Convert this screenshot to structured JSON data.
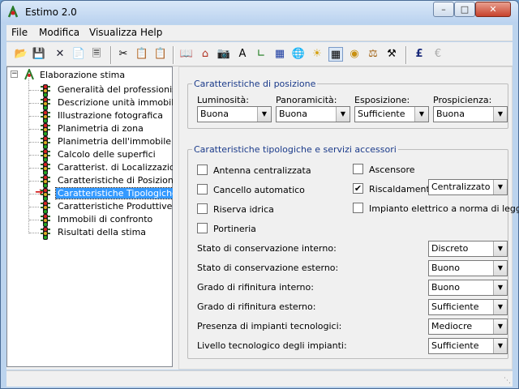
{
  "window": {
    "title": "Estimo 2.0",
    "min": "–",
    "max": "□",
    "close": "✕"
  },
  "menu": [
    "File",
    "Modifica",
    "Visualizza",
    "Help"
  ],
  "toolbar": {
    "euro": "€",
    "pound": "£"
  },
  "tree": {
    "root": "Elaborazione stima",
    "items": [
      "Generalità del professionista",
      "Descrizione unità immobiliare",
      "Illustrazione fotografica",
      "Planimetria di zona",
      "Planimetria dell'immobile",
      "Calcolo delle superfici",
      "Caratterist. di Localizzazione",
      "Caratteristiche di Posizione",
      "Caratteristiche Tipologiche",
      "Caratteristiche Produttive",
      "Immobili di confronto",
      "Risultati della stima"
    ],
    "selected_index": 8
  },
  "posizione": {
    "legend": "Caratteristiche di posizione",
    "fields": [
      {
        "label": "Luminosità:",
        "value": "Buona"
      },
      {
        "label": "Panoramicità:",
        "value": "Buona"
      },
      {
        "label": "Esposizione:",
        "value": "Sufficiente"
      },
      {
        "label": "Prospicienza:",
        "value": "Buona"
      }
    ]
  },
  "tipologiche": {
    "legend": "Caratteristiche tipologiche e servizi accessori",
    "checks": [
      {
        "label": "Antenna centralizzata",
        "checked": false
      },
      {
        "label": "Cancello automatico",
        "checked": false
      },
      {
        "label": "Riserva idrica",
        "checked": false
      },
      {
        "label": "Portineria",
        "checked": false
      },
      {
        "label": "Ascensore",
        "checked": false
      },
      {
        "label": "Riscaldamento",
        "checked": true,
        "value": "Centralizzato"
      },
      {
        "label": "Impianto elettrico a norma di legge",
        "checked": false
      }
    ],
    "rows": [
      {
        "label": "Stato di conservazione interno:",
        "value": "Discreto"
      },
      {
        "label": "Stato di conservazione esterno:",
        "value": "Buono"
      },
      {
        "label": "Grado di rifinitura interno:",
        "value": "Buono"
      },
      {
        "label": "Grado di rifinitura esterno:",
        "value": "Sufficiente"
      },
      {
        "label": "Presenza di impianti tecnologici:",
        "value": "Mediocre"
      },
      {
        "label": "Livello tecnologico degli impianti:",
        "value": "Sufficiente"
      }
    ]
  },
  "icons": {
    "dropdown_arrow": "▼",
    "check": "✔"
  }
}
